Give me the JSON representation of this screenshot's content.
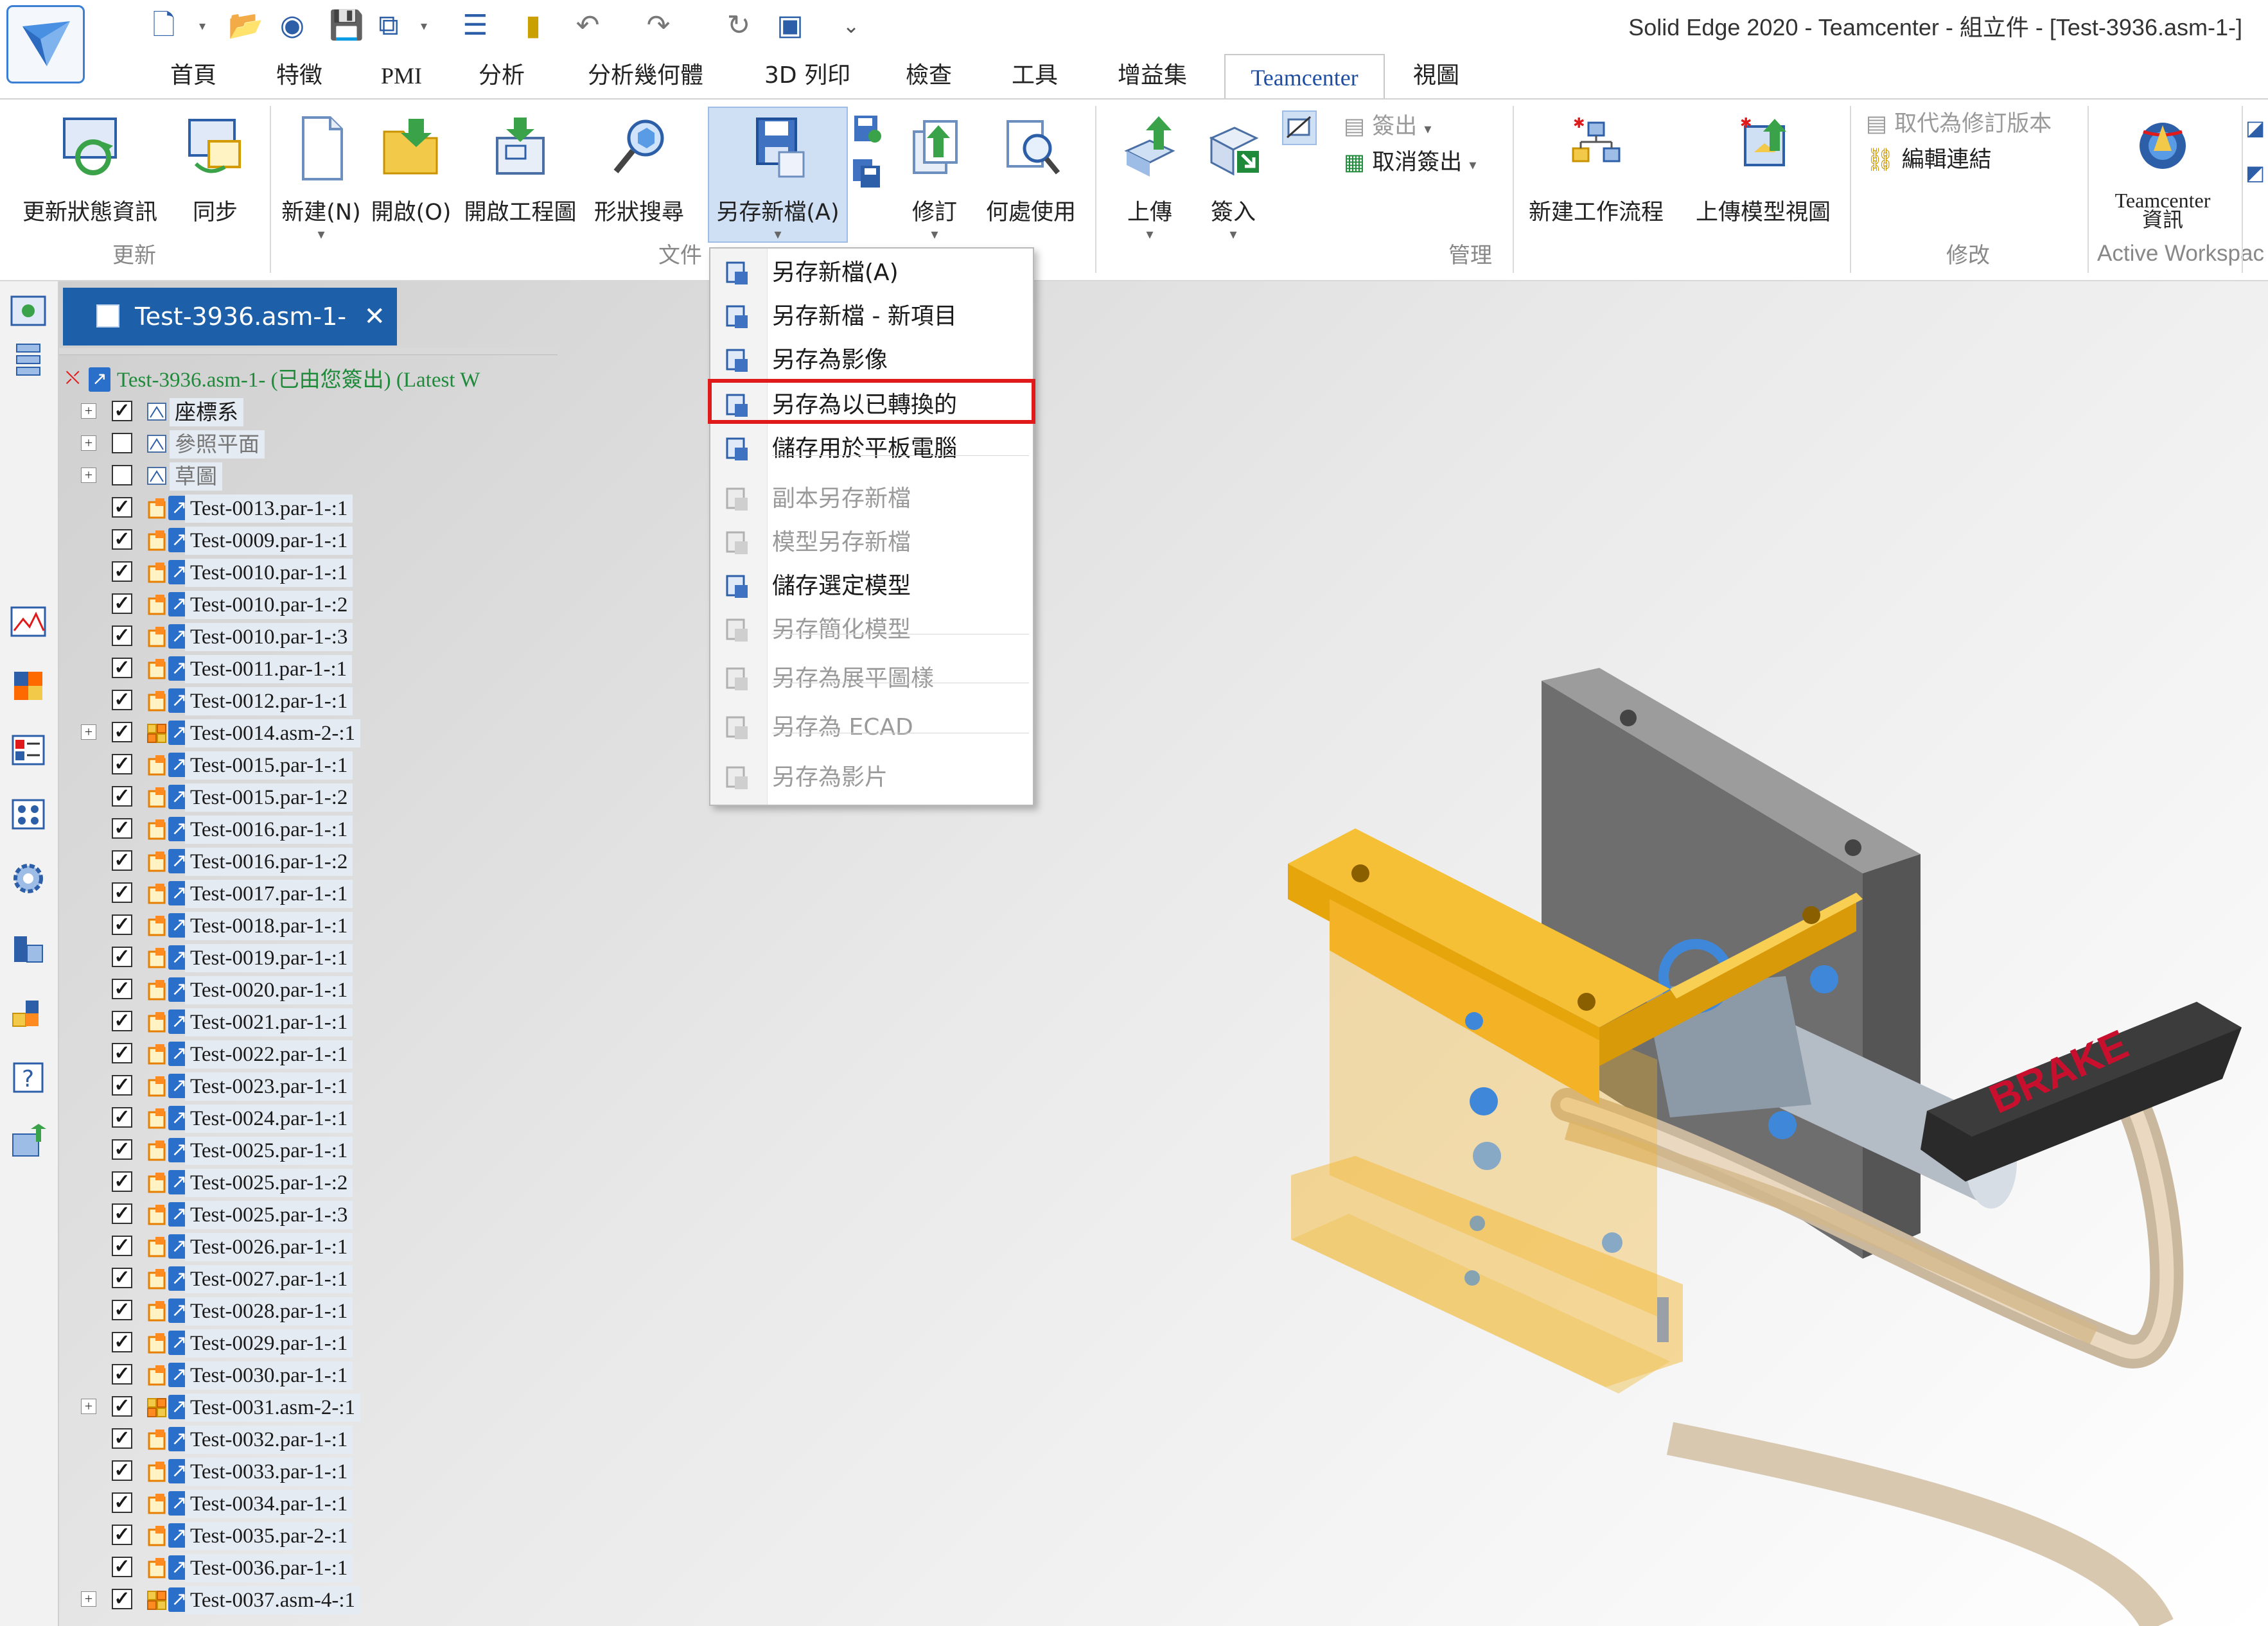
{
  "window_title": "Solid Edge 2020 - Teamcenter - 組立件 - [Test-3936.asm-1-]",
  "ribbon_tabs": [
    "首頁",
    "特徵",
    "PMI",
    "分析",
    "分析幾何體",
    "3D 列印",
    "檢查",
    "工具",
    "增益集",
    "Teamcenter",
    "視圖"
  ],
  "active_tab": "Teamcenter",
  "ribbon": {
    "buttons": {
      "refresh_status": "更新狀態資訊",
      "sync": "同步",
      "new": "新建(N)",
      "open": "開啟(O)",
      "open_drawing": "開啟工程圖",
      "shape_search": "形狀搜尋",
      "save_as": "另存新檔(A)",
      "revise": "修訂",
      "where_used": "何處使用",
      "upload": "上傳",
      "check_in": "簽入",
      "check_out": "簽出",
      "cancel_check_out": "取消簽出",
      "new_workflow": "新建工作流程",
      "upload_model_view": "上傳模型視圖",
      "replace_revision": "取代為修訂版本",
      "edit_link": "編輯連結",
      "teamcenter_info_line1": "Teamcenter",
      "teamcenter_info_line2": "資訊"
    },
    "groups": {
      "update": "更新",
      "file": "文件",
      "manage": "管理",
      "modify": "修改",
      "active_workspace": "Active Workspac"
    }
  },
  "save_as_menu": {
    "items": [
      {
        "label": "另存新檔(A)",
        "enabled": true
      },
      {
        "label": "另存新檔 - 新項目",
        "enabled": true
      },
      {
        "label": "另存為影像",
        "enabled": true
      },
      {
        "label": "另存為以已轉換的",
        "enabled": true,
        "highlighted": true
      },
      {
        "label": "儲存用於平板電腦",
        "enabled": true
      },
      {
        "label": "副本另存新檔",
        "enabled": false
      },
      {
        "label": "模型另存新檔",
        "enabled": false
      },
      {
        "label": "儲存選定模型",
        "enabled": true
      },
      {
        "label": "另存簡化模型",
        "enabled": false
      },
      {
        "label": "另存為展平圖樣",
        "enabled": false
      },
      {
        "label": "另存為 ECAD",
        "enabled": false
      },
      {
        "label": "另存為影片",
        "enabled": false
      }
    ]
  },
  "document_tab": "Test-3936.asm-1-",
  "pathfinder": {
    "root": "Test-3936.asm-1- (已由您簽出) (Latest W",
    "items": [
      {
        "label": "座標系",
        "checked": true,
        "expandable": true
      },
      {
        "label": "參照平面",
        "checked": false,
        "expandable": true
      },
      {
        "label": "草圖",
        "checked": false,
        "expandable": true
      },
      {
        "label": "Test-0013.par-1-:1",
        "checked": true
      },
      {
        "label": "Test-0009.par-1-:1",
        "checked": true
      },
      {
        "label": "Test-0010.par-1-:1",
        "checked": true
      },
      {
        "label": "Test-0010.par-1-:2",
        "checked": true
      },
      {
        "label": "Test-0010.par-1-:3",
        "checked": true
      },
      {
        "label": "Test-0011.par-1-:1",
        "checked": true
      },
      {
        "label": "Test-0012.par-1-:1",
        "checked": true
      },
      {
        "label": "Test-0014.asm-2-:1",
        "checked": true,
        "expandable": true
      },
      {
        "label": "Test-0015.par-1-:1",
        "checked": true
      },
      {
        "label": "Test-0015.par-1-:2",
        "checked": true
      },
      {
        "label": "Test-0016.par-1-:1",
        "checked": true
      },
      {
        "label": "Test-0016.par-1-:2",
        "checked": true
      },
      {
        "label": "Test-0017.par-1-:1",
        "checked": true
      },
      {
        "label": "Test-0018.par-1-:1",
        "checked": true
      },
      {
        "label": "Test-0019.par-1-:1",
        "checked": true
      },
      {
        "label": "Test-0020.par-1-:1",
        "checked": true
      },
      {
        "label": "Test-0021.par-1-:1",
        "checked": true
      },
      {
        "label": "Test-0022.par-1-:1",
        "checked": true
      },
      {
        "label": "Test-0023.par-1-:1",
        "checked": true
      },
      {
        "label": "Test-0024.par-1-:1",
        "checked": true
      },
      {
        "label": "Test-0025.par-1-:1",
        "checked": true
      },
      {
        "label": "Test-0025.par-1-:2",
        "checked": true
      },
      {
        "label": "Test-0025.par-1-:3",
        "checked": true
      },
      {
        "label": "Test-0026.par-1-:1",
        "checked": true
      },
      {
        "label": "Test-0027.par-1-:1",
        "checked": true
      },
      {
        "label": "Test-0028.par-1-:1",
        "checked": true
      },
      {
        "label": "Test-0029.par-1-:1",
        "checked": true
      },
      {
        "label": "Test-0030.par-1-:1",
        "checked": true
      },
      {
        "label": "Test-0031.asm-2-:1",
        "checked": true,
        "expandable": true
      },
      {
        "label": "Test-0032.par-1-:1",
        "checked": true
      },
      {
        "label": "Test-0033.par-1-:1",
        "checked": true
      },
      {
        "label": "Test-0034.par-1-:1",
        "checked": true
      },
      {
        "label": "Test-0035.par-2-:1",
        "checked": true
      },
      {
        "label": "Test-0036.par-1-:1",
        "checked": true
      },
      {
        "label": "Test-0037.asm-4-:1",
        "checked": true,
        "expandable": true
      }
    ]
  },
  "model_decal_text": "BRAKE",
  "colors": {
    "accent": "#1d5fa8",
    "highlight_box": "#e01a1a",
    "bracket": "#f4b326",
    "tab_text": "#1f4ea1"
  }
}
